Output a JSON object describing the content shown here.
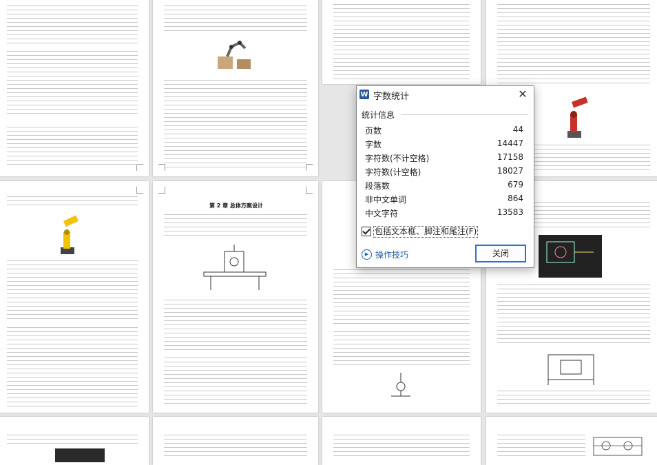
{
  "document": {
    "chapter_heading": "第 2 章  总体方案设计"
  },
  "dialog": {
    "title": "字数统计",
    "section_label": "统计信息",
    "stats": [
      {
        "label": "页数",
        "value": "44"
      },
      {
        "label": "字数",
        "value": "14447"
      },
      {
        "label": "字符数(不计空格)",
        "value": "17158"
      },
      {
        "label": "字符数(计空格)",
        "value": "18027"
      },
      {
        "label": "段落数",
        "value": "679"
      },
      {
        "label": "非中文单词",
        "value": "864"
      },
      {
        "label": "中文字符",
        "value": "13583"
      }
    ],
    "include_checkbox_label": "包括文本框、脚注和尾注(F)",
    "include_checked": true,
    "tips_label": "操作技巧",
    "close_label": "关闭"
  },
  "icons": {
    "app": "word-icon",
    "close": "close-icon",
    "tips": "play-circle-icon"
  },
  "colors": {
    "accent": "#2f6fd1",
    "link": "#1f5fb0",
    "word_blue": "#2b5797",
    "robot_yellow": "#f2c300",
    "robot_red": "#c8312a"
  }
}
